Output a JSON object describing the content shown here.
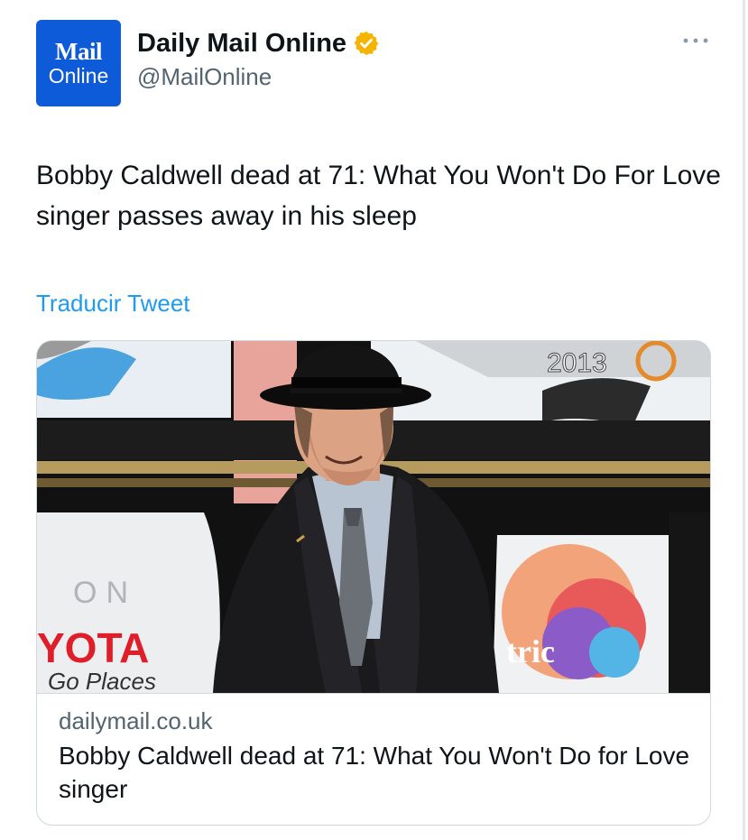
{
  "account": {
    "avatar_line1": "Mail",
    "avatar_line2": "Online",
    "display_name": "Daily Mail Online",
    "handle": "@MailOnline",
    "verified": true
  },
  "tweet": {
    "text": "Bobby Caldwell dead at 71: What You Won't Do For Love singer passes away in his sleep",
    "translate_label": "Traducir Tweet"
  },
  "card": {
    "image_texts": {
      "year_badge": "2013",
      "sign_left_top": "ON",
      "sign_left_brand": "YOTA",
      "sign_left_tagline": "Go Places",
      "sign_right": "tric"
    },
    "domain": "dailymail.co.uk",
    "title": "Bobby Caldwell dead at 71: What You Won't Do for Love singer"
  },
  "icons": {
    "verified": "verified-badge-icon",
    "more": "more-options-icon"
  },
  "colors": {
    "avatar_bg": "#0d5bd8",
    "verified_gold": "#f4b400",
    "link_blue": "#1d9bf0",
    "secondary_text": "#536471",
    "border": "#cfd9de"
  }
}
